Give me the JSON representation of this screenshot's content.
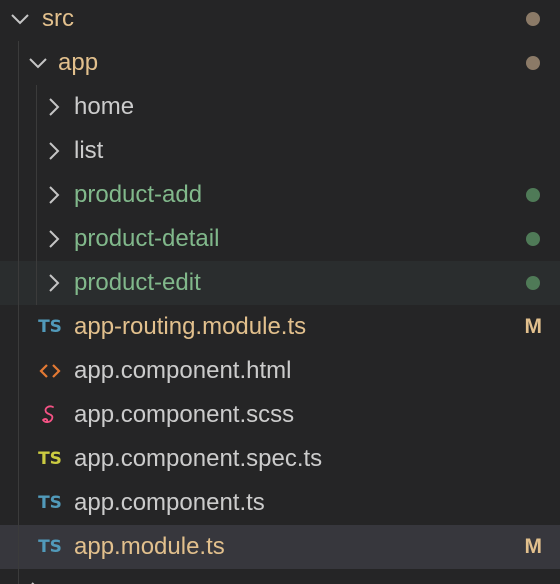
{
  "tree": {
    "src": {
      "label": "src",
      "decoration": "dot",
      "color": "#8b7a67"
    },
    "app": {
      "label": "app",
      "decoration": "dot",
      "color": "#8b7a67"
    },
    "folders": [
      {
        "label": "home",
        "decoration": "none"
      },
      {
        "label": "list",
        "decoration": "none"
      },
      {
        "label": "product-add",
        "decoration": "dot",
        "color": "#81b88b"
      },
      {
        "label": "product-detail",
        "decoration": "dot",
        "color": "#81b88b"
      },
      {
        "label": "product-edit",
        "decoration": "dot",
        "color": "#81b88b"
      }
    ],
    "files": [
      {
        "label": "app-routing.module.ts",
        "icon": "typescript-icon",
        "icon_text": "TS",
        "icon_color": "#519aba",
        "badge": "M",
        "status": "modified"
      },
      {
        "label": "app.component.html",
        "icon": "html-brackets-icon",
        "icon_text": "<>",
        "icon_color": "#e37933",
        "badge": "",
        "status": "normal"
      },
      {
        "label": "app.component.scss",
        "icon": "sass-icon",
        "icon_text": "S",
        "icon_color": "#f55385",
        "badge": "",
        "status": "normal"
      },
      {
        "label": "app.component.spec.ts",
        "icon": "typescript-test-icon",
        "icon_text": "TS",
        "icon_color": "#cbcb41",
        "badge": "",
        "status": "normal"
      },
      {
        "label": "app.component.ts",
        "icon": "typescript-icon",
        "icon_text": "TS",
        "icon_color": "#519aba",
        "badge": "",
        "status": "normal"
      },
      {
        "label": "app.module.ts",
        "icon": "typescript-icon",
        "icon_text": "TS",
        "icon_color": "#519aba",
        "badge": "M",
        "status": "modified"
      }
    ]
  },
  "colors": {
    "background": "#252526",
    "hover_row": "#2a2d2e",
    "selected_row": "#37373d",
    "modified": "#e2c08d",
    "added": "#81b88b",
    "text": "#cccccc"
  }
}
